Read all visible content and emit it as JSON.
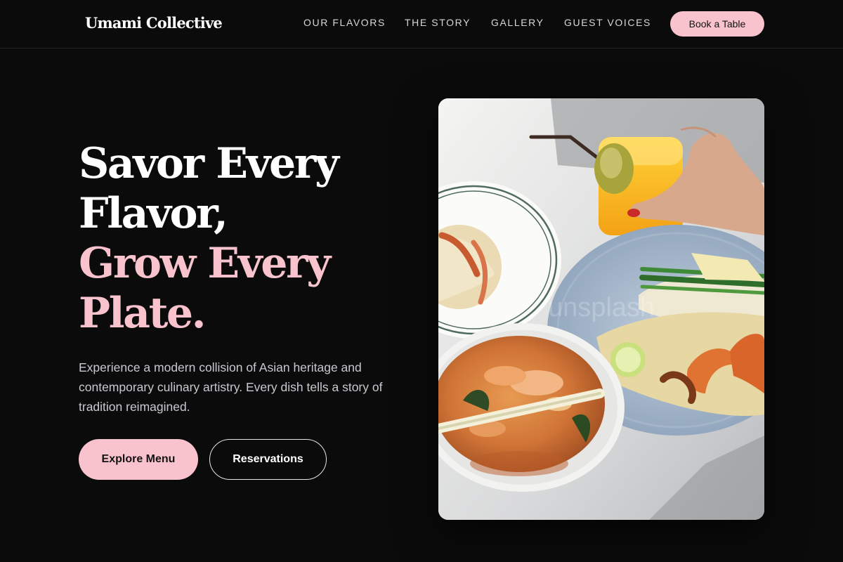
{
  "brand": {
    "name": "Umami Collective"
  },
  "nav": {
    "links": [
      {
        "label": "OUR FLAVORS"
      },
      {
        "label": "THE STORY"
      },
      {
        "label": "GALLERY"
      },
      {
        "label": "GUEST VOICES"
      }
    ],
    "cta_label": "Book a Table"
  },
  "hero": {
    "headline_line1": "Savor Every",
    "headline_line2": "Flavor,",
    "headline_line3": "Grow Every",
    "headline_line4": "Plate.",
    "description": "Experience a modern collision of Asian heritage and contemporary culinary artistry. Every dish tells a story of tradition reimagined.",
    "primary_button": "Explore Menu",
    "secondary_button": "Reservations",
    "image_subject": "overhead photo of Asian dishes: tom yum soup, pad thai with shrimp and lime, pasta plate, hand holding orange drink",
    "watermark": "unsplash"
  },
  "colors": {
    "background": "#0b0b0c",
    "accent_pink": "#f9c3ce",
    "text_white": "#ffffff",
    "text_muted": "#c9c9d0"
  }
}
